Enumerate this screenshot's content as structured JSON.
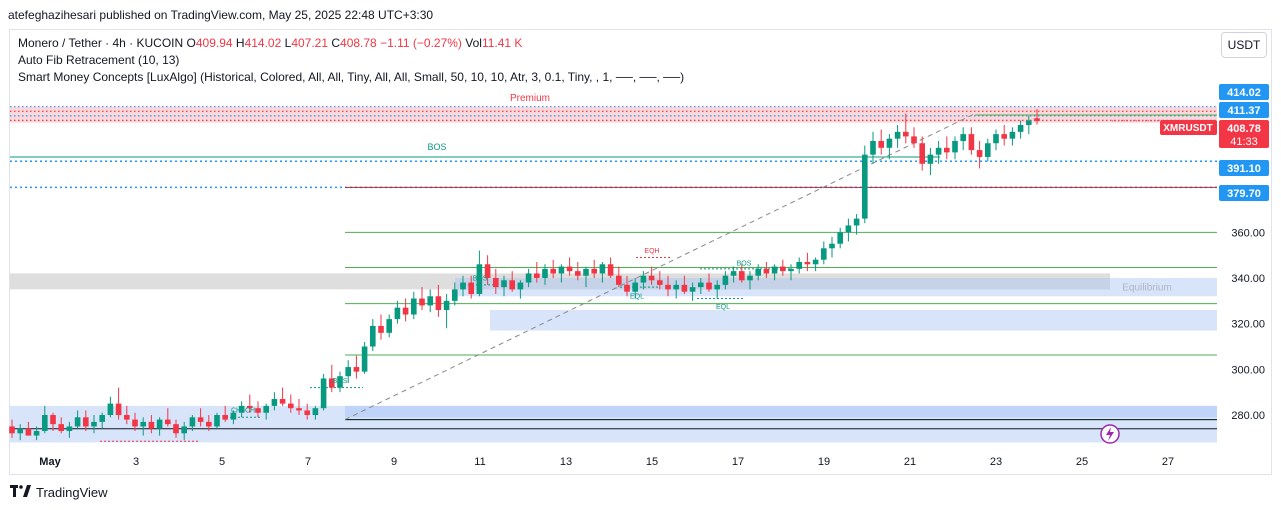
{
  "header": {
    "publisher_line": "atefeghazihesari published on TradingView.com, May 25, 2025 22:48 UTC+3:30"
  },
  "legend": {
    "symbol": "Monero / Tether · 4h · KUCOIN",
    "o_label": "O",
    "o_value": "409.94",
    "h_label": "H",
    "h_value": "414.02",
    "l_label": "L",
    "l_value": "407.21",
    "c_label": "C",
    "c_value": "408.78",
    "change": "−1.11 (−0.27%)",
    "vol_label": "Vol",
    "vol_value": "11.41 K",
    "indicator_1": "Auto Fib Retracement (10, 13)",
    "indicator_2": "Smart Money Concepts [LuxAlgo] (Historical, Colored, All, All, Tiny, All, All, Small, 50, 10, 10, Atr, 3, 0.1, Tiny, , 1, ──, ──, ──)"
  },
  "currency_button": "USDT",
  "footer": {
    "brand": "TradingView"
  },
  "colors": {
    "up": "#089981",
    "down": "#f23645",
    "blue": "#2196f3",
    "zone_blue": "#a7c4f5",
    "premium": "#f7b8bd",
    "fib_green": "#4caf50",
    "fib_red": "#b22833"
  },
  "chart_data": {
    "type": "candlestick",
    "symbol": "XMRUSDT",
    "timeframe": "4h",
    "x_ticks": [
      "May",
      "3",
      "5",
      "7",
      "9",
      "11",
      "13",
      "15",
      "17",
      "19",
      "21",
      "23",
      "25",
      "27"
    ],
    "y_ticks": [
      280,
      300,
      320,
      340,
      360
    ],
    "ylim": [
      266,
      421
    ],
    "price_labels": [
      {
        "text": "414.02",
        "value": 414.02,
        "style": "blue"
      },
      {
        "text": "411.37",
        "value": 411.37,
        "style": "blue"
      },
      {
        "text": "391.10",
        "value": 391.1,
        "style": "blue"
      },
      {
        "text": "379.70",
        "value": 379.7,
        "style": "blue"
      }
    ],
    "last_price": {
      "symbol": "XMRUSDT",
      "value": 408.78,
      "text": "408.78",
      "countdown": "41:33"
    },
    "fib_levels": [
      {
        "value": 411.37,
        "color": "#4caf50"
      },
      {
        "value": 379.7,
        "color": "#b22833"
      },
      {
        "value": 360.0,
        "color": "#4caf50"
      },
      {
        "value": 344.6,
        "color": "#4caf50"
      },
      {
        "value": 328.8,
        "color": "#4caf50"
      },
      {
        "value": 306.3,
        "color": "#4caf50"
      },
      {
        "value": 278.0,
        "color": "#4caf50"
      }
    ],
    "zones": [
      {
        "name": "premium",
        "from": 408,
        "to": 415
      },
      {
        "name": "equilibrium",
        "from": 335,
        "to": 342
      },
      {
        "name": "demand-1",
        "from": 332,
        "to": 340
      },
      {
        "name": "demand-2",
        "from": 317,
        "to": 326
      },
      {
        "name": "discount",
        "from": 268,
        "to": 284
      }
    ],
    "labels": [
      "Premium",
      "BOS",
      "BOS",
      "BOS",
      "BOS",
      "CHoCH",
      "EQH",
      "EQL",
      "EQL",
      "Equilibrium"
    ],
    "candles": [
      {
        "o": 275,
        "h": 278,
        "l": 270,
        "c": 272
      },
      {
        "o": 272,
        "h": 276,
        "l": 269,
        "c": 274
      },
      {
        "o": 274,
        "h": 277,
        "l": 271,
        "c": 271
      },
      {
        "o": 271,
        "h": 275,
        "l": 269,
        "c": 273
      },
      {
        "o": 273,
        "h": 284,
        "l": 272,
        "c": 280
      },
      {
        "o": 280,
        "h": 281,
        "l": 273,
        "c": 276
      },
      {
        "o": 276,
        "h": 279,
        "l": 272,
        "c": 273
      },
      {
        "o": 273,
        "h": 277,
        "l": 270,
        "c": 275
      },
      {
        "o": 275,
        "h": 282,
        "l": 274,
        "c": 279
      },
      {
        "o": 279,
        "h": 282,
        "l": 273,
        "c": 275
      },
      {
        "o": 275,
        "h": 280,
        "l": 272,
        "c": 277
      },
      {
        "o": 277,
        "h": 281,
        "l": 274,
        "c": 280
      },
      {
        "o": 280,
        "h": 288,
        "l": 279,
        "c": 285
      },
      {
        "o": 285,
        "h": 292,
        "l": 278,
        "c": 280
      },
      {
        "o": 280,
        "h": 284,
        "l": 276,
        "c": 278
      },
      {
        "o": 278,
        "h": 281,
        "l": 273,
        "c": 275
      },
      {
        "o": 275,
        "h": 279,
        "l": 271,
        "c": 277
      },
      {
        "o": 277,
        "h": 280,
        "l": 272,
        "c": 274
      },
      {
        "o": 274,
        "h": 279,
        "l": 271,
        "c": 278
      },
      {
        "o": 278,
        "h": 283,
        "l": 275,
        "c": 276
      },
      {
        "o": 276,
        "h": 278,
        "l": 270,
        "c": 272
      },
      {
        "o": 272,
        "h": 277,
        "l": 269,
        "c": 275
      },
      {
        "o": 275,
        "h": 280,
        "l": 273,
        "c": 279
      },
      {
        "o": 279,
        "h": 283,
        "l": 275,
        "c": 277
      },
      {
        "o": 277,
        "h": 280,
        "l": 273,
        "c": 275
      },
      {
        "o": 275,
        "h": 281,
        "l": 274,
        "c": 280
      },
      {
        "o": 280,
        "h": 284,
        "l": 277,
        "c": 278
      },
      {
        "o": 278,
        "h": 282,
        "l": 276,
        "c": 281
      },
      {
        "o": 281,
        "h": 286,
        "l": 279,
        "c": 284
      },
      {
        "o": 284,
        "h": 289,
        "l": 281,
        "c": 283
      },
      {
        "o": 283,
        "h": 286,
        "l": 279,
        "c": 281
      },
      {
        "o": 281,
        "h": 285,
        "l": 278,
        "c": 284
      },
      {
        "o": 284,
        "h": 290,
        "l": 282,
        "c": 287
      },
      {
        "o": 287,
        "h": 292,
        "l": 284,
        "c": 285
      },
      {
        "o": 285,
        "h": 289,
        "l": 281,
        "c": 283
      },
      {
        "o": 283,
        "h": 287,
        "l": 280,
        "c": 282
      },
      {
        "o": 282,
        "h": 285,
        "l": 278,
        "c": 280
      },
      {
        "o": 280,
        "h": 284,
        "l": 278,
        "c": 283
      },
      {
        "o": 283,
        "h": 298,
        "l": 282,
        "c": 296
      },
      {
        "o": 296,
        "h": 302,
        "l": 290,
        "c": 292
      },
      {
        "o": 292,
        "h": 299,
        "l": 290,
        "c": 297
      },
      {
        "o": 297,
        "h": 304,
        "l": 294,
        "c": 301
      },
      {
        "o": 301,
        "h": 306,
        "l": 296,
        "c": 299
      },
      {
        "o": 299,
        "h": 312,
        "l": 298,
        "c": 310
      },
      {
        "o": 310,
        "h": 322,
        "l": 308,
        "c": 319
      },
      {
        "o": 319,
        "h": 324,
        "l": 313,
        "c": 316
      },
      {
        "o": 316,
        "h": 324,
        "l": 314,
        "c": 322
      },
      {
        "o": 322,
        "h": 330,
        "l": 320,
        "c": 327
      },
      {
        "o": 327,
        "h": 331,
        "l": 321,
        "c": 324
      },
      {
        "o": 324,
        "h": 334,
        "l": 322,
        "c": 331
      },
      {
        "o": 331,
        "h": 336,
        "l": 326,
        "c": 328
      },
      {
        "o": 328,
        "h": 335,
        "l": 325,
        "c": 332
      },
      {
        "o": 332,
        "h": 337,
        "l": 323,
        "c": 326
      },
      {
        "o": 326,
        "h": 333,
        "l": 318,
        "c": 330
      },
      {
        "o": 330,
        "h": 338,
        "l": 328,
        "c": 335
      },
      {
        "o": 335,
        "h": 341,
        "l": 332,
        "c": 338
      },
      {
        "o": 338,
        "h": 341,
        "l": 331,
        "c": 333
      },
      {
        "o": 333,
        "h": 352,
        "l": 332,
        "c": 346
      },
      {
        "o": 346,
        "h": 350,
        "l": 337,
        "c": 340
      },
      {
        "o": 340,
        "h": 344,
        "l": 333,
        "c": 336
      },
      {
        "o": 336,
        "h": 341,
        "l": 332,
        "c": 339
      },
      {
        "o": 339,
        "h": 343,
        "l": 334,
        "c": 335
      },
      {
        "o": 335,
        "h": 339,
        "l": 331,
        "c": 338
      },
      {
        "o": 338,
        "h": 344,
        "l": 336,
        "c": 342
      },
      {
        "o": 342,
        "h": 347,
        "l": 338,
        "c": 340
      },
      {
        "o": 340,
        "h": 346,
        "l": 337,
        "c": 344
      },
      {
        "o": 344,
        "h": 348,
        "l": 340,
        "c": 342
      },
      {
        "o": 342,
        "h": 346,
        "l": 338,
        "c": 345
      },
      {
        "o": 345,
        "h": 349,
        "l": 341,
        "c": 343
      },
      {
        "o": 343,
        "h": 347,
        "l": 339,
        "c": 341
      },
      {
        "o": 341,
        "h": 345,
        "l": 336,
        "c": 344
      },
      {
        "o": 344,
        "h": 348,
        "l": 340,
        "c": 342
      },
      {
        "o": 342,
        "h": 347,
        "l": 338,
        "c": 346
      },
      {
        "o": 346,
        "h": 349,
        "l": 340,
        "c": 341
      },
      {
        "o": 341,
        "h": 345,
        "l": 336,
        "c": 337
      },
      {
        "o": 337,
        "h": 341,
        "l": 332,
        "c": 334
      },
      {
        "o": 334,
        "h": 340,
        "l": 331,
        "c": 338
      },
      {
        "o": 338,
        "h": 343,
        "l": 335,
        "c": 341
      },
      {
        "o": 341,
        "h": 345,
        "l": 337,
        "c": 339
      },
      {
        "o": 339,
        "h": 343,
        "l": 335,
        "c": 337
      },
      {
        "o": 337,
        "h": 341,
        "l": 332,
        "c": 335
      },
      {
        "o": 335,
        "h": 339,
        "l": 331,
        "c": 337
      },
      {
        "o": 337,
        "h": 341,
        "l": 333,
        "c": 334
      },
      {
        "o": 334,
        "h": 338,
        "l": 330,
        "c": 336
      },
      {
        "o": 336,
        "h": 340,
        "l": 333,
        "c": 338
      },
      {
        "o": 338,
        "h": 342,
        "l": 334,
        "c": 335
      },
      {
        "o": 335,
        "h": 339,
        "l": 331,
        "c": 337
      },
      {
        "o": 337,
        "h": 343,
        "l": 335,
        "c": 341
      },
      {
        "o": 341,
        "h": 345,
        "l": 338,
        "c": 343
      },
      {
        "o": 343,
        "h": 346,
        "l": 338,
        "c": 339
      },
      {
        "o": 339,
        "h": 343,
        "l": 335,
        "c": 341
      },
      {
        "o": 341,
        "h": 346,
        "l": 339,
        "c": 344
      },
      {
        "o": 344,
        "h": 347,
        "l": 340,
        "c": 342
      },
      {
        "o": 342,
        "h": 346,
        "l": 339,
        "c": 345
      },
      {
        "o": 345,
        "h": 348,
        "l": 341,
        "c": 343
      },
      {
        "o": 343,
        "h": 346,
        "l": 339,
        "c": 344
      },
      {
        "o": 344,
        "h": 349,
        "l": 342,
        "c": 347
      },
      {
        "o": 347,
        "h": 351,
        "l": 343,
        "c": 346
      },
      {
        "o": 346,
        "h": 349,
        "l": 343,
        "c": 348
      },
      {
        "o": 348,
        "h": 356,
        "l": 346,
        "c": 353
      },
      {
        "o": 353,
        "h": 358,
        "l": 349,
        "c": 355
      },
      {
        "o": 355,
        "h": 362,
        "l": 353,
        "c": 360
      },
      {
        "o": 360,
        "h": 366,
        "l": 356,
        "c": 363
      },
      {
        "o": 363,
        "h": 368,
        "l": 359,
        "c": 366
      },
      {
        "o": 366,
        "h": 398,
        "l": 364,
        "c": 394
      },
      {
        "o": 394,
        "h": 404,
        "l": 390,
        "c": 400
      },
      {
        "o": 400,
        "h": 405,
        "l": 394,
        "c": 397
      },
      {
        "o": 397,
        "h": 403,
        "l": 392,
        "c": 401
      },
      {
        "o": 401,
        "h": 407,
        "l": 397,
        "c": 404
      },
      {
        "o": 404,
        "h": 412,
        "l": 399,
        "c": 402
      },
      {
        "o": 402,
        "h": 406,
        "l": 397,
        "c": 399
      },
      {
        "o": 399,
        "h": 402,
        "l": 387,
        "c": 390
      },
      {
        "o": 390,
        "h": 397,
        "l": 385,
        "c": 394
      },
      {
        "o": 394,
        "h": 400,
        "l": 390,
        "c": 397
      },
      {
        "o": 397,
        "h": 402,
        "l": 392,
        "c": 395
      },
      {
        "o": 395,
        "h": 402,
        "l": 392,
        "c": 400
      },
      {
        "o": 400,
        "h": 406,
        "l": 396,
        "c": 403
      },
      {
        "o": 403,
        "h": 406,
        "l": 394,
        "c": 396
      },
      {
        "o": 396,
        "h": 400,
        "l": 388,
        "c": 393
      },
      {
        "o": 393,
        "h": 401,
        "l": 391,
        "c": 399
      },
      {
        "o": 399,
        "h": 405,
        "l": 396,
        "c": 403
      },
      {
        "o": 403,
        "h": 407,
        "l": 398,
        "c": 401
      },
      {
        "o": 401,
        "h": 406,
        "l": 398,
        "c": 404
      },
      {
        "o": 404,
        "h": 409,
        "l": 401,
        "c": 407
      },
      {
        "o": 407,
        "h": 411,
        "l": 403,
        "c": 409
      },
      {
        "o": 409.94,
        "h": 414.02,
        "l": 407.21,
        "c": 408.78
      }
    ]
  }
}
